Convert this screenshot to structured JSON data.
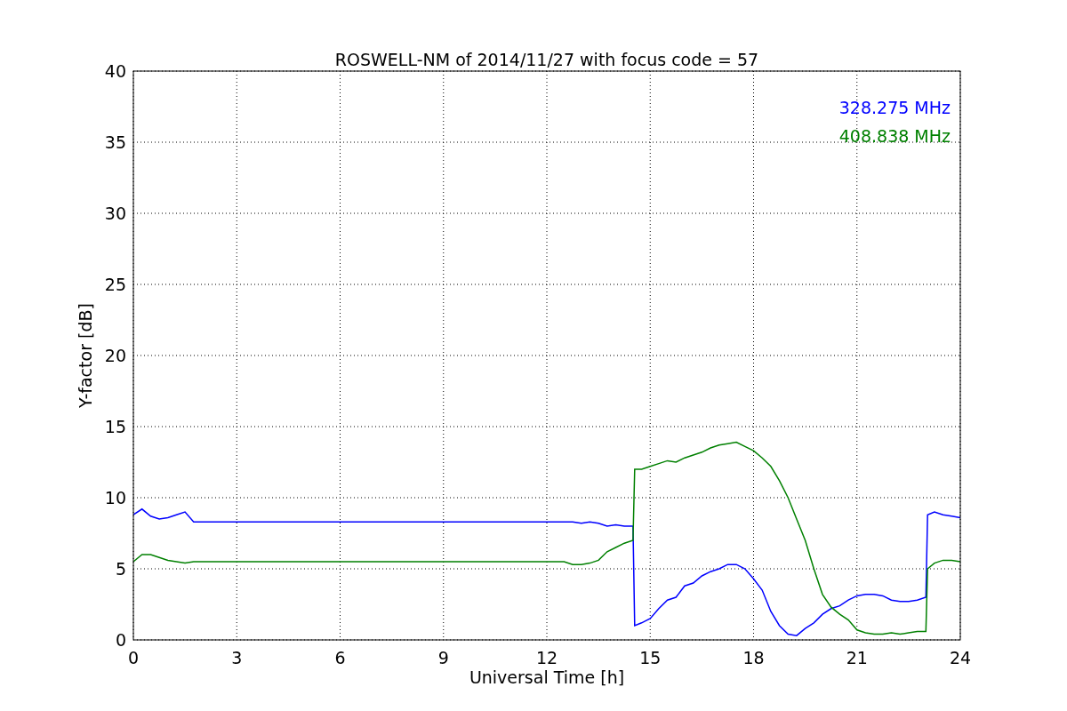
{
  "chart_data": {
    "type": "line",
    "title": "ROSWELL-NM of 2014/11/27 with focus code = 57",
    "xlabel": "Universal Time [h]",
    "ylabel": "Y-factor [dB]",
    "x": [
      0,
      0.25,
      0.5,
      0.75,
      1,
      1.25,
      1.5,
      1.75,
      12.5,
      12.75,
      13,
      13.25,
      13.5,
      13.75,
      14,
      14.25,
      14.5,
      14.55,
      14.75,
      15,
      15.25,
      15.5,
      15.75,
      16,
      16.25,
      16.5,
      16.75,
      17,
      17.25,
      17.5,
      17.75,
      18,
      18.25,
      18.5,
      18.75,
      19,
      19.25,
      19.5,
      19.75,
      20,
      20.25,
      20.5,
      20.75,
      21,
      21.25,
      21.5,
      21.75,
      22,
      22.25,
      22.5,
      22.75,
      23,
      23.05,
      23.25,
      23.5,
      23.75,
      24
    ],
    "series": [
      {
        "name": "328.275 MHz",
        "color": "#0000ff",
        "values": [
          8.8,
          9.2,
          8.7,
          8.5,
          8.6,
          8.8,
          9.0,
          8.3,
          8.3,
          8.3,
          8.2,
          8.3,
          8.2,
          8.0,
          8.1,
          8.0,
          8.0,
          1.0,
          1.2,
          1.5,
          2.2,
          2.8,
          3.0,
          3.8,
          4.0,
          4.5,
          4.8,
          5.0,
          5.3,
          5.3,
          5.0,
          4.3,
          3.5,
          2.0,
          1.0,
          0.4,
          0.3,
          0.8,
          1.2,
          1.8,
          2.2,
          2.4,
          2.8,
          3.1,
          3.2,
          3.2,
          3.1,
          2.8,
          2.7,
          2.7,
          2.8,
          3.0,
          8.8,
          9.0,
          8.8,
          8.7,
          8.6
        ]
      },
      {
        "name": "408.838 MHz",
        "color": "#008000",
        "values": [
          5.5,
          6.0,
          6.0,
          5.8,
          5.6,
          5.5,
          5.4,
          5.5,
          5.5,
          5.3,
          5.3,
          5.4,
          5.6,
          6.2,
          6.5,
          6.8,
          7.0,
          12.0,
          12.0,
          12.2,
          12.4,
          12.6,
          12.5,
          12.8,
          13.0,
          13.2,
          13.5,
          13.7,
          13.8,
          13.9,
          13.6,
          13.3,
          12.8,
          12.2,
          11.2,
          10.0,
          8.5,
          7.0,
          5.0,
          3.2,
          2.3,
          1.8,
          1.4,
          0.7,
          0.5,
          0.4,
          0.4,
          0.5,
          0.4,
          0.5,
          0.6,
          0.6,
          5.0,
          5.4,
          5.6,
          5.6,
          5.5
        ]
      }
    ],
    "grid": true,
    "xlim": [
      0,
      24
    ],
    "ylim": [
      0,
      40
    ],
    "xticks": [
      0,
      3,
      6,
      9,
      12,
      15,
      18,
      21,
      24
    ],
    "yticks": [
      0,
      5,
      10,
      15,
      20,
      25,
      30,
      35,
      40
    ]
  }
}
